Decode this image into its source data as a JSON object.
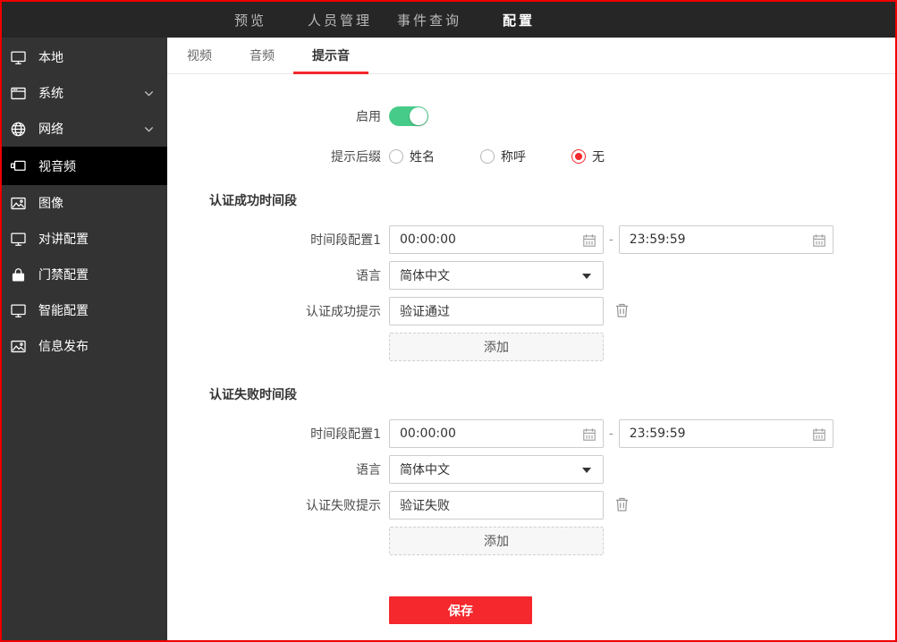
{
  "header": {
    "nav": [
      {
        "name": "preview",
        "label": "预览",
        "active": false
      },
      {
        "name": "person-management",
        "label": "人员管理",
        "active": false
      },
      {
        "name": "event-search",
        "label": "事件查询",
        "active": false
      },
      {
        "name": "configuration",
        "label": "配置",
        "active": true
      }
    ]
  },
  "sidebar": {
    "items": [
      {
        "name": "local",
        "label": "本地",
        "icon": "monitor-icon",
        "active": false,
        "expandable": false
      },
      {
        "name": "system",
        "label": "系统",
        "icon": "window-icon",
        "active": false,
        "expandable": true
      },
      {
        "name": "network",
        "label": "网络",
        "icon": "globe-icon",
        "active": false,
        "expandable": true
      },
      {
        "name": "video-audio",
        "label": "视音频",
        "icon": "av-icon",
        "active": true,
        "expandable": false
      },
      {
        "name": "image",
        "label": "图像",
        "icon": "image-icon",
        "active": false,
        "expandable": false
      },
      {
        "name": "intercom-config",
        "label": "对讲配置",
        "icon": "monitor-icon",
        "active": false,
        "expandable": false
      },
      {
        "name": "access-control-config",
        "label": "门禁配置",
        "icon": "lock-icon",
        "active": false,
        "expandable": false
      },
      {
        "name": "smart-config",
        "label": "智能配置",
        "icon": "monitor-icon",
        "active": false,
        "expandable": false
      },
      {
        "name": "info-release",
        "label": "信息发布",
        "icon": "image-icon",
        "active": false,
        "expandable": false
      }
    ]
  },
  "tabs": [
    {
      "name": "video",
      "label": "视频",
      "active": false
    },
    {
      "name": "audio",
      "label": "音频",
      "active": false
    },
    {
      "name": "prompt-sound",
      "label": "提示音",
      "active": true
    }
  ],
  "form": {
    "enable": {
      "label": "启用",
      "state": "on"
    },
    "suffix": {
      "label": "提示后缀",
      "options": [
        {
          "label": "姓名",
          "selected": false
        },
        {
          "label": "称呼",
          "selected": false
        },
        {
          "label": "无",
          "selected": true
        }
      ]
    },
    "success": {
      "title": "认证成功时间段",
      "time_label": "时间段配置1",
      "time_start": "00:00:00",
      "time_separator": "-",
      "time_end": "23:59:59",
      "language_label": "语言",
      "language_value": "简体中文",
      "prompt_label": "认证成功提示",
      "prompt_value": "验证通过",
      "add_label": "添加"
    },
    "failure": {
      "title": "认证失败时间段",
      "time_label": "时间段配置1",
      "time_start": "00:00:00",
      "time_separator": "-",
      "time_end": "23:59:59",
      "language_label": "语言",
      "language_value": "简体中文",
      "prompt_label": "认证失败提示",
      "prompt_value": "验证失败",
      "add_label": "添加"
    },
    "save_label": "保存"
  },
  "colors": {
    "accent": "#f4282d",
    "border_red": "#ee0000",
    "toggle_on": "#47cb89",
    "header_bg": "#262626",
    "sidebar_bg": "#333333",
    "sidebar_active_bg": "#000000"
  }
}
